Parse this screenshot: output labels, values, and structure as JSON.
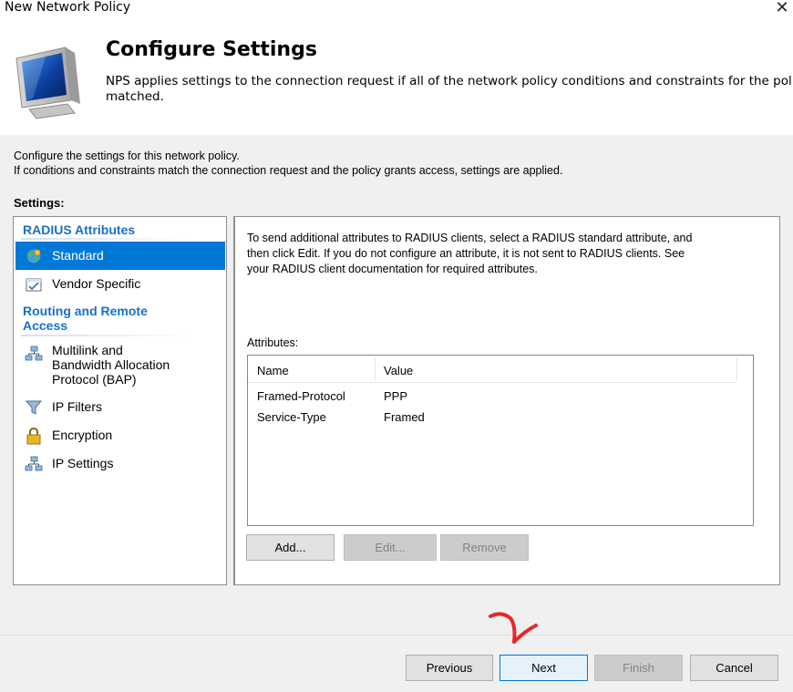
{
  "window": {
    "title": "New Network Policy",
    "close_symbol": "✕"
  },
  "header": {
    "title": "Configure Settings",
    "description_line1": "NPS applies settings to the connection request if all of the network policy conditions and constraints for the policy are",
    "description_line2": "matched."
  },
  "intro": {
    "line1": "Configure the settings for this network policy.",
    "line2": "If conditions and constraints match the connection request and the policy grants access, settings are applied."
  },
  "settings_label": "Settings:",
  "sidebar": {
    "categories": [
      {
        "label": "RADIUS Attributes"
      },
      {
        "label_line1": "Routing and Remote",
        "label_line2": "Access"
      }
    ],
    "items": [
      {
        "label": "Standard",
        "icon": "globe-icon",
        "selected": true
      },
      {
        "label": "Vendor Specific",
        "icon": "checklist-icon",
        "selected": false
      },
      {
        "label_line1": "Multilink and",
        "label_line2": "Bandwidth Allocation",
        "label_line3": "Protocol (BAP)",
        "icon": "network-icon",
        "selected": false
      },
      {
        "label": "IP Filters",
        "icon": "filter-icon",
        "selected": false
      },
      {
        "label": "Encryption",
        "icon": "lock-icon",
        "selected": false
      },
      {
        "label": "IP Settings",
        "icon": "network-icon",
        "selected": false
      }
    ]
  },
  "main": {
    "description_line1": "To send additional attributes to RADIUS clients, select a RADIUS standard attribute, and",
    "description_line2": "then click Edit. If you do not configure an attribute, it is not sent to RADIUS clients. See",
    "description_line3": "your RADIUS client documentation for required attributes.",
    "attributes_label": "Attributes:",
    "columns": [
      "Name",
      "Value"
    ],
    "rows": [
      {
        "name": "Framed-Protocol",
        "value": "PPP"
      },
      {
        "name": "Service-Type",
        "value": "Framed"
      }
    ],
    "buttons": {
      "add": "Add...",
      "edit": "Edit...",
      "remove": "Remove"
    }
  },
  "footer": {
    "buttons": {
      "previous": "Previous",
      "next": "Next",
      "finish": "Finish",
      "cancel": "Cancel"
    }
  },
  "colors": {
    "accent": "#0078d7",
    "category_text": "#1a6fc4",
    "annotation": "#e8262a"
  }
}
